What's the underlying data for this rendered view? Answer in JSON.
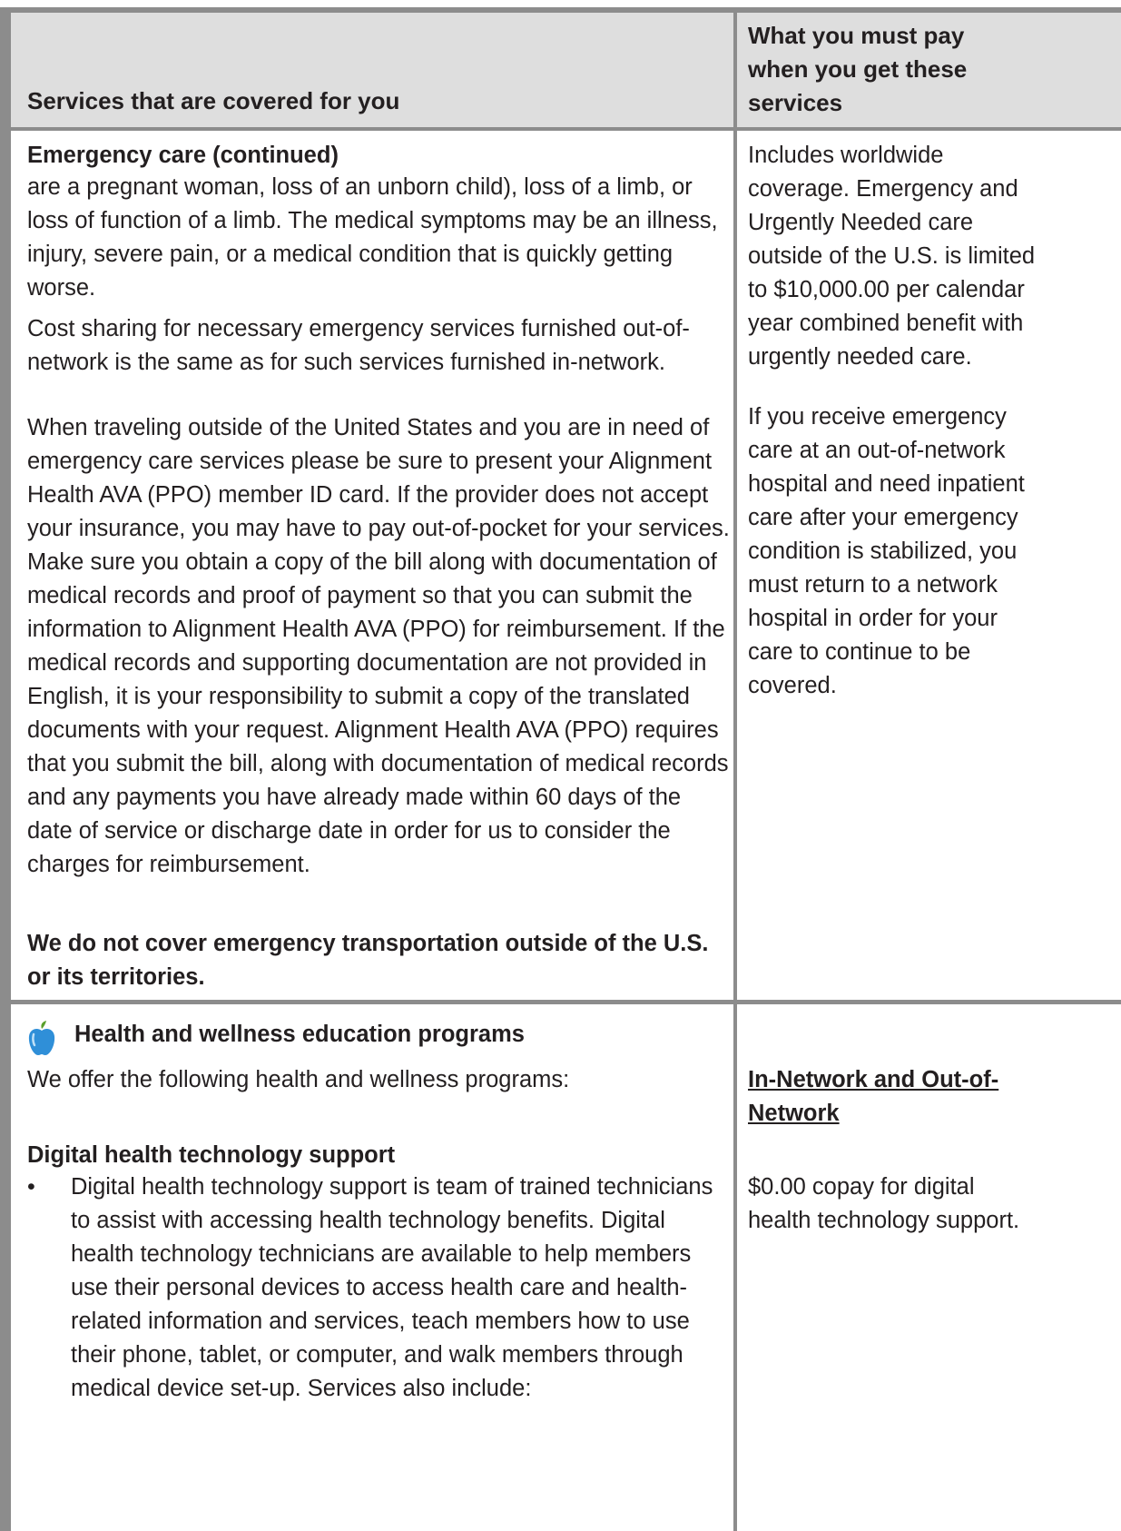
{
  "header": {
    "col1": "Services that are covered for you",
    "col2": "What you must pay when you get these services"
  },
  "emergency": {
    "heading": "Emergency care (continued)",
    "para1": "are a pregnant woman, loss of an unborn child), loss of a limb, or loss of function of a limb. The medical symptoms may be an illness, injury, severe pain, or a medical condition that is quickly getting worse.",
    "para2": "Cost sharing for necessary emergency services furnished out-of-network is the same as for such services furnished in-network.",
    "para3": "When traveling outside of the United States and you are in need of emergency care services please be sure to present your Alignment Health AVA (PPO) member ID card. If the provider does not accept your insurance, you may have to pay out-of-pocket for your services. Make sure you obtain a copy of the bill along with documentation of medical records and proof of payment so that you can submit the information to Alignment Health AVA (PPO) for reimbursement. If the medical records and supporting documentation are not provided in English, it is your responsibility to submit a copy of the translated documents with your request. Alignment Health AVA (PPO) requires that you submit the bill, along with documentation of medical records and any payments you have already made within 60 days of the date of service or discharge date in order for us to consider the charges for reimbursement.",
    "para4": "We do not cover emergency transportation outside of the U.S. or its territories.",
    "pay1": "Includes worldwide coverage. Emergency and Urgently Needed care outside of the U.S. is limited to $10,000.00 per calendar year combined benefit with urgently needed care.",
    "pay2": "If you receive emergency care at an out-of-network hospital and need inpatient care after your emergency condition is stabilized, you must return to a network hospital in order for your care to continue to be covered."
  },
  "wellness": {
    "icon": "apple-icon",
    "heading": "Health and wellness education programs",
    "intro": "We offer the following health and wellness programs:",
    "network_label": "In-Network and Out-of-Network",
    "subheading": "Digital health technology support",
    "bullet1": "Digital health technology support is team of trained technicians to assist with accessing health technology benefits. Digital health technology technicians are available to help members use their personal devices to access health care and health-related information and services, teach members how to use their phone, tablet, or computer, and walk members through medical device set-up. Services also include:",
    "pay": "$0.00 copay for digital health technology support."
  },
  "colors": {
    "header_bg": "#dedede",
    "border": "#8c8c8c",
    "apple_blue": "#2f8fd8"
  }
}
